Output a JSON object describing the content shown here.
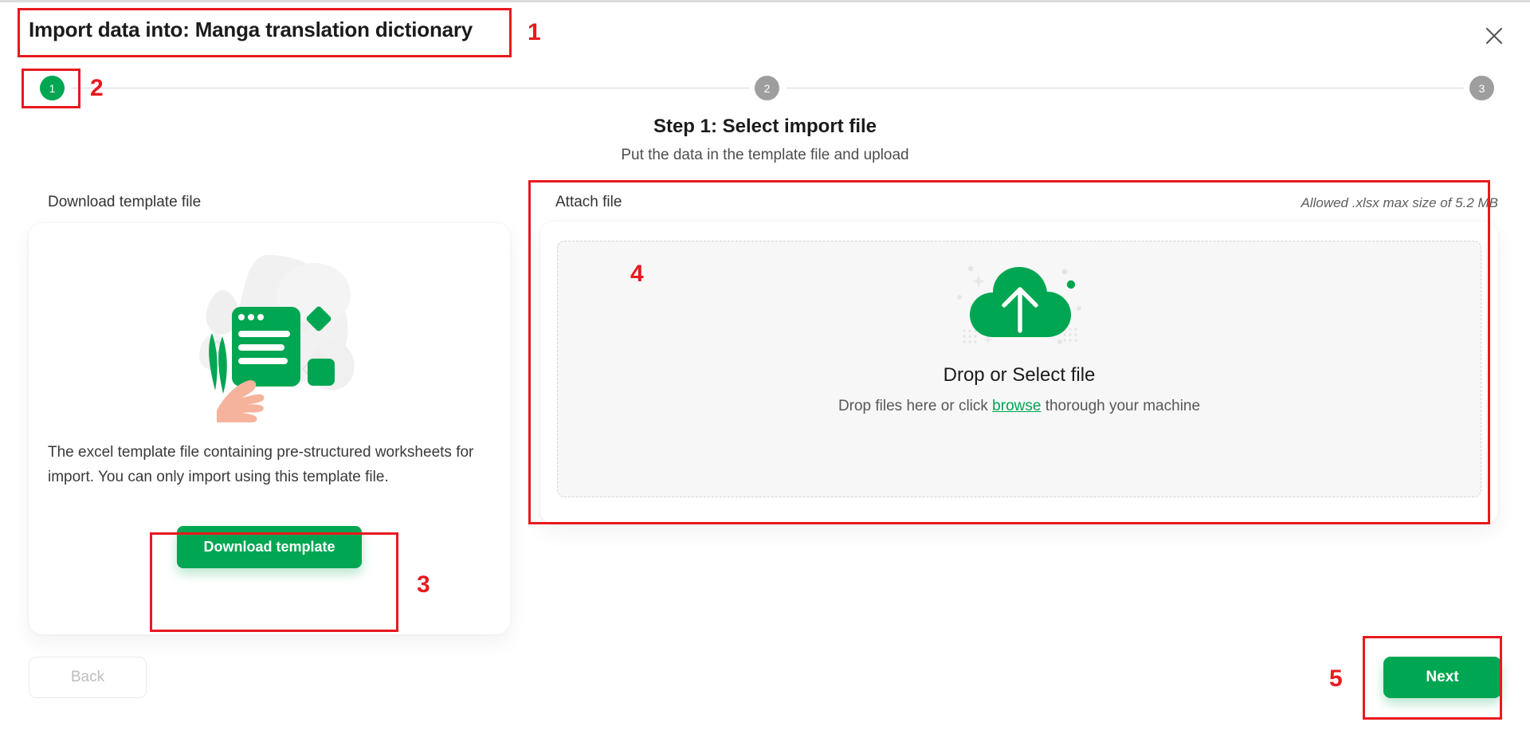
{
  "dialog": {
    "title": "Import data into: Manga translation dictionary",
    "close_icon": "close-icon"
  },
  "stepper": {
    "steps": [
      {
        "number": "1",
        "state": "active"
      },
      {
        "number": "2",
        "state": "inactive"
      },
      {
        "number": "3",
        "state": "inactive"
      }
    ],
    "active_color": "#00A651",
    "inactive_color": "#9E9E9E"
  },
  "step": {
    "heading": "Step 1: Select import file",
    "subheading": "Put the data in the template file and upload"
  },
  "left_panel": {
    "label": "Download template file",
    "illustration_icon": "template-document-illustration",
    "description": "The excel template file containing pre-structured worksheets for import. You can only import using this template file.",
    "download_button": "Download template"
  },
  "right_panel": {
    "label": "Attach file",
    "hint": "Allowed .xlsx max size of 5.2 MB",
    "dropzone": {
      "icon": "upload-cloud-icon",
      "title": "Drop or Select file",
      "text_before": "Drop files here or click ",
      "link": "browse",
      "text_after": " thorough your machine"
    }
  },
  "footer": {
    "back_label": "Back",
    "next_label": "Next"
  },
  "annotations": [
    {
      "id": "1",
      "label": "1"
    },
    {
      "id": "2",
      "label": "2"
    },
    {
      "id": "3",
      "label": "3"
    },
    {
      "id": "4",
      "label": "4"
    },
    {
      "id": "5",
      "label": "5"
    }
  ],
  "colors": {
    "brand_green": "#00A651",
    "annotation_red": "#E8191F",
    "dropzone_bg": "#F7F7F7"
  }
}
